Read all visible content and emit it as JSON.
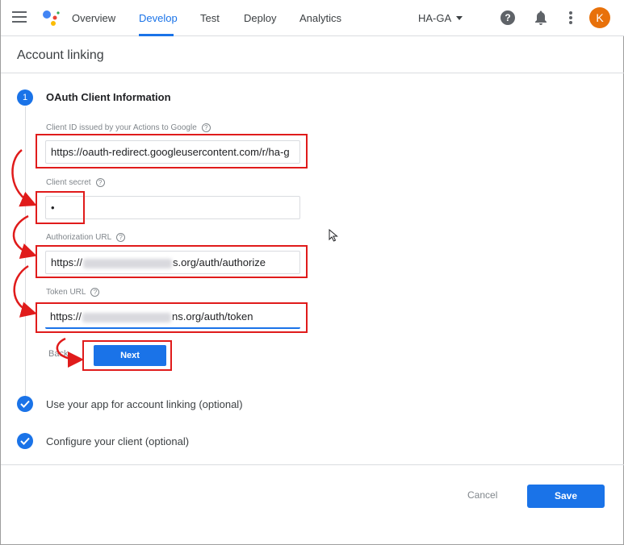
{
  "topbar": {
    "tabs": [
      {
        "label": "Overview"
      },
      {
        "label": "Develop"
      },
      {
        "label": "Test"
      },
      {
        "label": "Deploy"
      },
      {
        "label": "Analytics"
      }
    ],
    "active_tab": "Develop",
    "project": "HA-GA",
    "avatar_initial": "K"
  },
  "page": {
    "title": "Account linking"
  },
  "step1": {
    "number": "1",
    "title": "OAuth Client Information",
    "client_id": {
      "label": "Client ID issued by your Actions to Google",
      "value": "https://oauth-redirect.googleusercontent.com/r/ha-g"
    },
    "client_secret": {
      "label": "Client secret",
      "value": "•"
    },
    "authorization_url": {
      "label": "Authorization URL",
      "prefix": "https://",
      "suffix": "s.org/auth/authorize"
    },
    "token_url": {
      "label": "Token URL",
      "prefix": "https://",
      "suffix": "ns.org/auth/token"
    },
    "back_label": "Back",
    "next_label": "Next"
  },
  "step2": {
    "label": "Use your app for account linking (optional)"
  },
  "step3": {
    "label": "Configure your client (optional)"
  },
  "footer": {
    "cancel_label": "Cancel",
    "save_label": "Save"
  },
  "colors": {
    "accent": "#1a73e8",
    "annotation": "#e01b1b",
    "avatar": "#e8710a"
  },
  "icons": {
    "help": "?",
    "field_help": "?"
  }
}
